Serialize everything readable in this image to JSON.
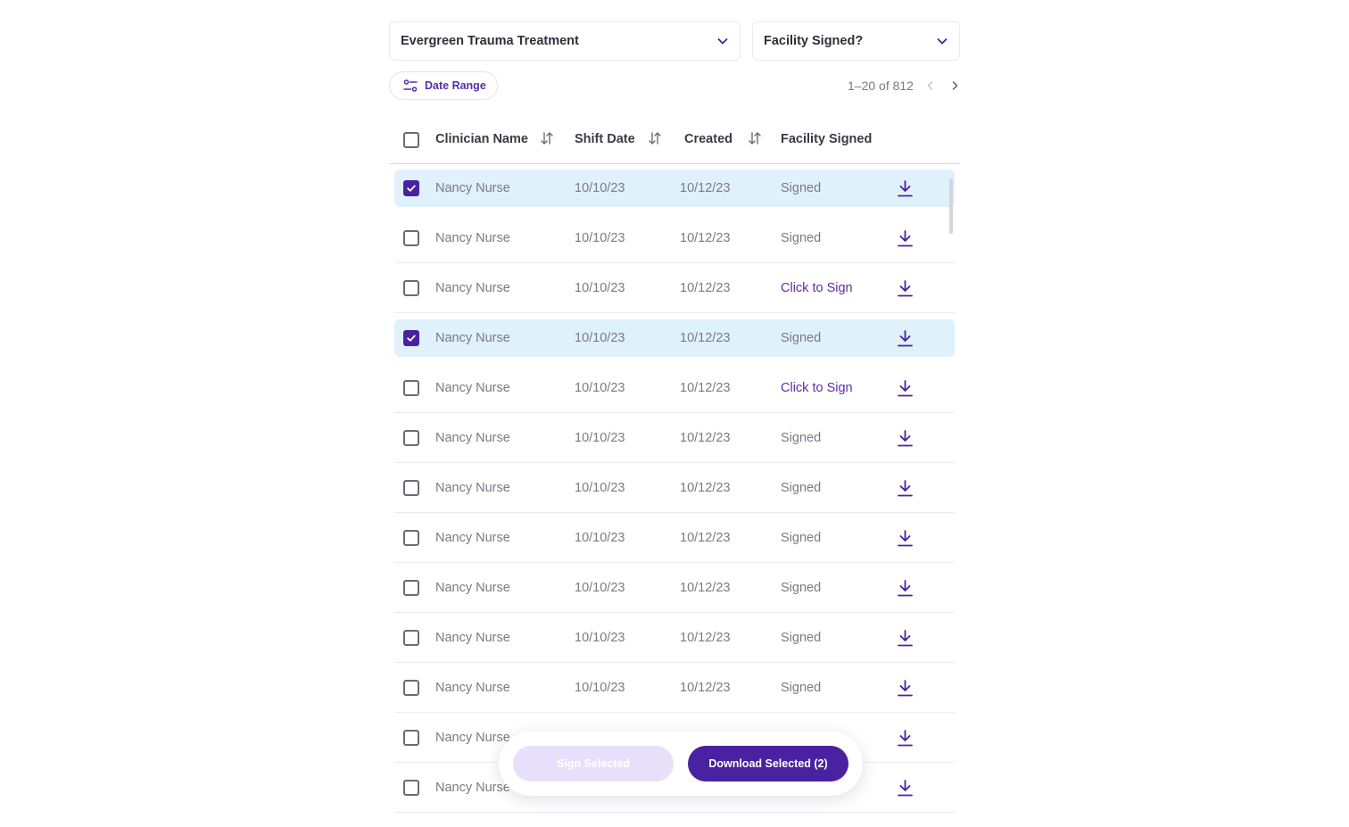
{
  "filters": {
    "facility": {
      "value": "Evergreen Trauma Treatment"
    },
    "signed": {
      "value": "Facility Signed?"
    },
    "date_range_label": "Date Range"
  },
  "pagination": {
    "label": "1–20 of 812"
  },
  "table": {
    "columns": [
      "Clinician Name",
      "Shift Date",
      "Created",
      "Facility Signed"
    ],
    "rows": [
      {
        "name": "Nancy Nurse",
        "shift": "10/10/23",
        "created": "10/12/23",
        "status": "Signed",
        "selected": true
      },
      {
        "name": "Nancy Nurse",
        "shift": "10/10/23",
        "created": "10/12/23",
        "status": "Signed",
        "selected": false
      },
      {
        "name": "Nancy Nurse",
        "shift": "10/10/23",
        "created": "10/12/23",
        "status": "Click to Sign",
        "selected": false
      },
      {
        "name": "Nancy Nurse",
        "shift": "10/10/23",
        "created": "10/12/23",
        "status": "Signed",
        "selected": true
      },
      {
        "name": "Nancy Nurse",
        "shift": "10/10/23",
        "created": "10/12/23",
        "status": "Click to Sign",
        "selected": false
      },
      {
        "name": "Nancy Nurse",
        "shift": "10/10/23",
        "created": "10/12/23",
        "status": "Signed",
        "selected": false
      },
      {
        "name": "Nancy Nurse",
        "shift": "10/10/23",
        "created": "10/12/23",
        "status": "Signed",
        "selected": false
      },
      {
        "name": "Nancy Nurse",
        "shift": "10/10/23",
        "created": "10/12/23",
        "status": "Signed",
        "selected": false
      },
      {
        "name": "Nancy Nurse",
        "shift": "10/10/23",
        "created": "10/12/23",
        "status": "Signed",
        "selected": false
      },
      {
        "name": "Nancy Nurse",
        "shift": "10/10/23",
        "created": "10/12/23",
        "status": "Signed",
        "selected": false
      },
      {
        "name": "Nancy Nurse",
        "shift": "10/10/23",
        "created": "10/12/23",
        "status": "Signed",
        "selected": false
      },
      {
        "name": "Nancy Nurse",
        "shift": "",
        "created": "",
        "status": "",
        "selected": false
      },
      {
        "name": "Nancy Nurse",
        "shift": "",
        "created": "",
        "status": "",
        "selected": false
      }
    ]
  },
  "actions": {
    "sign_label": "Sign Selected",
    "download_label": "Download Selected (2)"
  },
  "icons": {
    "dropdown": "chevron-down-icon",
    "date_range": "filter-sliders-icon",
    "sort": "sort-arrows-icon",
    "download": "download-icon",
    "check": "check-icon"
  },
  "colors": {
    "accent": "#4a21a0",
    "accent_text": "#5a2ea6",
    "selected_row": "#dff1fb",
    "disabled_button": "#e8e0fa"
  }
}
